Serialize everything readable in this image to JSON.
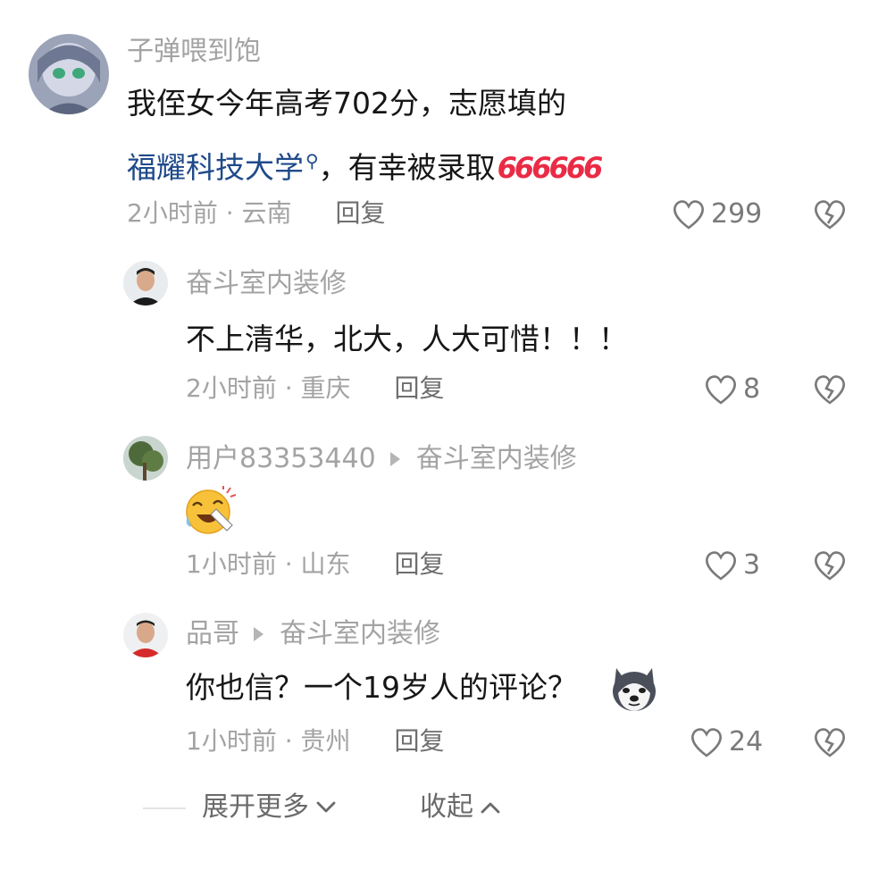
{
  "comments": [
    {
      "username": "子弹喂到饱",
      "text_line1": "我侄女今年高考702分，志愿填的",
      "link_text": "福耀科技大学",
      "text_line2_rest": "，有幸被录取",
      "six_text": "666666",
      "time": "2小时前",
      "location": "云南",
      "reply_label": "回复",
      "likes": "299"
    },
    {
      "username": "奋斗室内装修",
      "text": "不上清华，北大，人大可惜！！！",
      "time": "2小时前",
      "location": "重庆",
      "reply_label": "回复",
      "likes": "8"
    },
    {
      "username": "用户83353440",
      "reply_to": "奋斗室内装修",
      "time": "1小时前",
      "location": "山东",
      "reply_label": "回复",
      "likes": "3",
      "emoji": "crying-laughing-emoji"
    },
    {
      "username": "品哥",
      "reply_to": "奋斗室内装修",
      "text": "你也信？一个19岁人的评论？",
      "time": "1小时前",
      "location": "贵州",
      "reply_label": "回复",
      "likes": "24",
      "emoji": "husky-dog-emoji"
    }
  ],
  "footer": {
    "expand_label": "展开更多",
    "collapse_label": "收起"
  },
  "separator": "·",
  "colors": {
    "link": "#1f4a8a",
    "six": "#ea2b45",
    "meta": "#a3a3a3"
  }
}
